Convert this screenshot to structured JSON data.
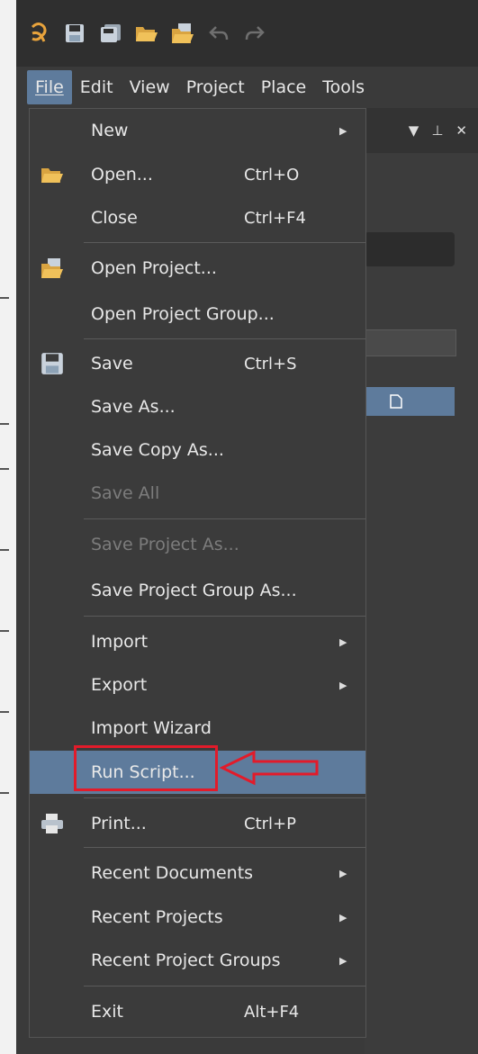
{
  "menubar": {
    "items": [
      "File",
      "Edit",
      "View",
      "Project",
      "Place",
      "Tools"
    ],
    "active": "File"
  },
  "quick_access": {
    "icons": [
      "app-logo-icon",
      "save-icon",
      "save-all-icon",
      "open-icon",
      "open-project-icon",
      "undo-icon",
      "redo-icon"
    ]
  },
  "panel": {
    "controls": [
      "▼",
      "⊥",
      "✕"
    ]
  },
  "file_menu": {
    "items": [
      {
        "label": "New",
        "submenu": true
      },
      {
        "label": "Open...",
        "shortcut": "Ctrl+O",
        "icon": "open-folder-icon"
      },
      {
        "label": "Close",
        "shortcut": "Ctrl+F4"
      },
      {
        "label": "Open Project...",
        "icon": "open-project-icon"
      },
      {
        "label": "Open Project Group..."
      },
      {
        "label": "Save",
        "shortcut": "Ctrl+S",
        "icon": "save-icon"
      },
      {
        "label": "Save As..."
      },
      {
        "label": "Save Copy As..."
      },
      {
        "label": "Save All",
        "disabled": true
      },
      {
        "label": "Save Project As...",
        "disabled": true
      },
      {
        "label": "Save Project Group As..."
      },
      {
        "label": "Import",
        "submenu": true
      },
      {
        "label": "Export",
        "submenu": true
      },
      {
        "label": "Import Wizard"
      },
      {
        "label": "Run Script...",
        "highlighted": true
      },
      {
        "label": "Print...",
        "shortcut": "Ctrl+P",
        "icon": "print-icon"
      },
      {
        "label": "Recent Documents",
        "submenu": true
      },
      {
        "label": "Recent Projects",
        "submenu": true
      },
      {
        "label": "Recent Project Groups",
        "submenu": true
      },
      {
        "label": "Exit",
        "shortcut": "Alt+F4"
      }
    ]
  },
  "colors": {
    "highlight": "#5e7b9c",
    "annotation_red": "#e21b2a",
    "menu_bg": "#3b3b3b"
  }
}
